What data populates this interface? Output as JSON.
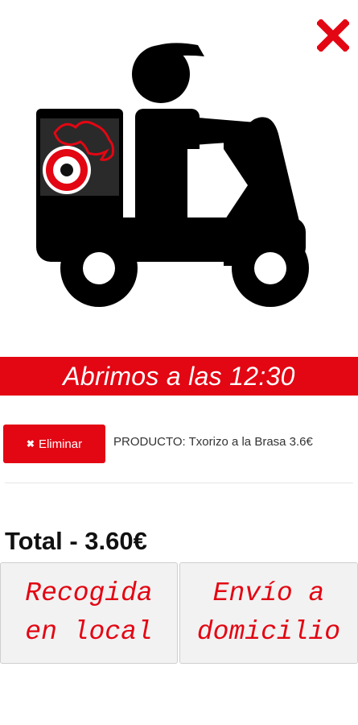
{
  "colors": {
    "accent": "#e30613",
    "icon_black": "#000000",
    "button_bg": "#f2f2f2"
  },
  "icons": {
    "close": "close-x-icon",
    "hero": "delivery-scooter-icon",
    "remove": "x-icon"
  },
  "banner": {
    "text": "Abrimos a las 12:30"
  },
  "cart": {
    "remove_label": "Eliminar",
    "product_text": "PRODUCTO: Txorizo a la Brasa 3.6€"
  },
  "total": {
    "text": "Total - 3.60€"
  },
  "options": {
    "pickup": {
      "line1": "Recogida",
      "line2": "en local"
    },
    "delivery": {
      "line1": "Envío a",
      "line2": "domicilio"
    }
  }
}
